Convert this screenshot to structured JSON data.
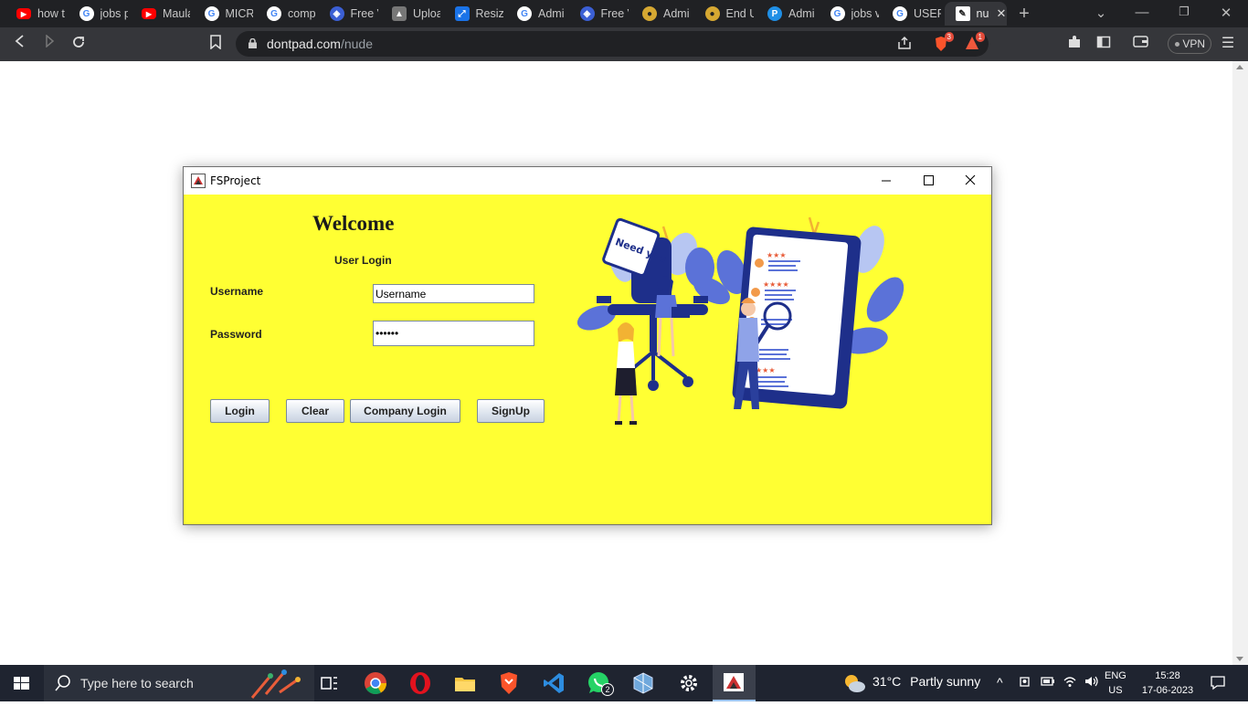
{
  "browser": {
    "tabs": [
      {
        "label": "how t",
        "icon": "youtube-icon"
      },
      {
        "label": "jobs p",
        "icon": "google-icon"
      },
      {
        "label": "Maula",
        "icon": "youtube-icon"
      },
      {
        "label": "MICR",
        "icon": "google-icon"
      },
      {
        "label": "comp",
        "icon": "google-icon"
      },
      {
        "label": "Free V",
        "icon": "shield-icon"
      },
      {
        "label": "Uploa",
        "icon": "upload-icon"
      },
      {
        "label": "Resize",
        "icon": "resize-icon"
      },
      {
        "label": "Admi",
        "icon": "google-icon"
      },
      {
        "label": "Free V",
        "icon": "shield-icon"
      },
      {
        "label": "Admi",
        "icon": "user-badge-icon"
      },
      {
        "label": "End U",
        "icon": "user-badge-icon"
      },
      {
        "label": "Admi",
        "icon": "pcloud-icon"
      },
      {
        "label": "jobs v",
        "icon": "google-icon"
      },
      {
        "label": "USERS",
        "icon": "google-icon"
      },
      {
        "label": "nu",
        "icon": "dontpad-icon",
        "active": true
      }
    ],
    "new_tab": "+",
    "url_host": "dontpad.com",
    "url_path": "/nude",
    "brave_badge": "3",
    "alert_badge": "1",
    "vpn_label": "VPN"
  },
  "app": {
    "title": "FSProject",
    "welcome": "Welcome",
    "user_login": "User Login",
    "username_label": "Username",
    "password_label": "Password",
    "username_value": "Username",
    "password_value": "••••••",
    "buttons": {
      "login": "Login",
      "clear": "Clear",
      "company_login": "Company Login",
      "signup": "SignUp"
    },
    "illustration_sign": "Need you",
    "colors": {
      "background": "#ffff33"
    }
  },
  "taskbar": {
    "search_placeholder": "Type here to search",
    "weather_temp": "31°C",
    "weather_desc": "Partly sunny",
    "lang_1": "ENG",
    "lang_2": "US",
    "time": "15:28",
    "date": "17-06-2023",
    "whatsapp_badge": "2"
  }
}
